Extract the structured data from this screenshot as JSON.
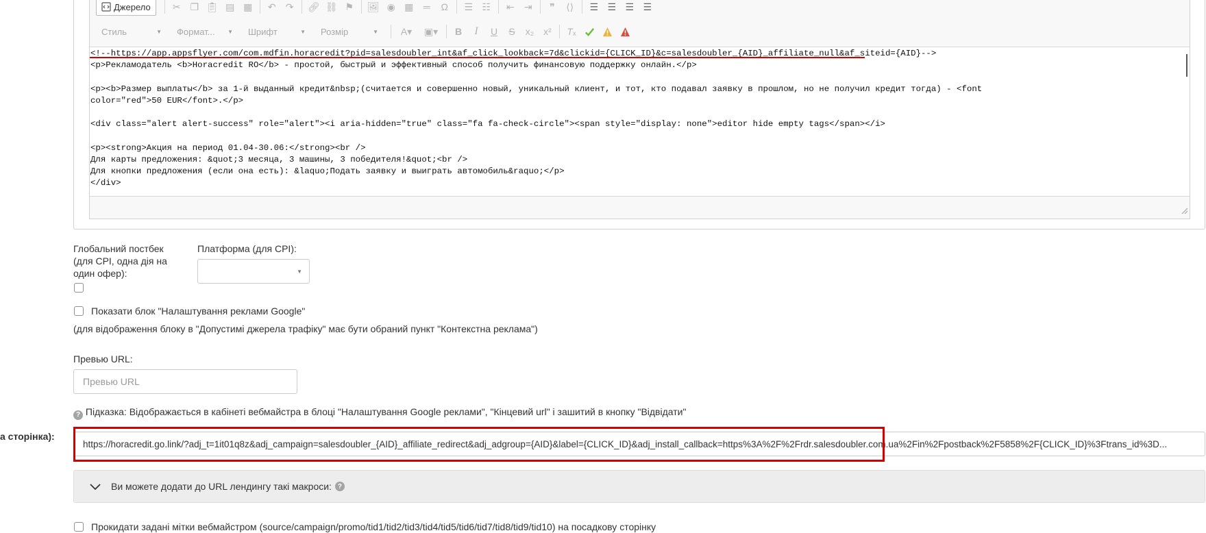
{
  "editor": {
    "source_button": "Джерело",
    "style_combo": "Стиль",
    "format_combo": "Формат...",
    "font_combo": "Шрифт",
    "size_combo": "Розмір",
    "code_lines": [
      "<!--https://app.appsflyer.com/com.mdfin.horacredit?pid=salesdoubler_int&af_click_lookback=7d&clickid={CLICK_ID}&c=salesdoubler_{AID}_affiliate_null&af_siteid={AID}-->",
      "<p>Рекламодатель <b>Horacredit RO</b> - простой, быстрый и эффективный способ получить финансовую поддержку онлайн.</p>",
      "",
      "<p><b>Размер выплаты</b> за 1-й выданный кредит&nbsp;(считается и совершенно новый, уникальный клиент, и тот, кто подавал заявку в прошлом, но не получил кредит тогда) - <font",
      "color=\"red\">50 EUR</font>.</p>",
      "",
      "<div class=\"alert alert-success\" role=\"alert\"><i aria-hidden=\"true\" class=\"fa fa-check-circle\"><span style=\"display: none\">editor hide empty tags</span></i>",
      "",
      "<p><strong>Акция на период 01.04-30.06:</strong><br />",
      "Для карты предложения: &quot;3 месяца, 3 машины, 3 победителя!&quot;<br />",
      "Для кнопки предложения (если она есть): &laquo;Подать заявку и выиграть автомобиль&raquo;</p>",
      "</div>"
    ]
  },
  "form": {
    "global_postback_label": "Глобальний постбек\n(для CPI, одна дія на\nодин офер):",
    "platform_label": "Платформа (для CPI):",
    "platform_value": "",
    "google_block_label": "Показати блок \"Налаштування реклами Google\"",
    "google_block_note": "(для відображення блоку в \"Допустимі джерела трафіку\" має бути обраний пункт \"Контекстна реклама\")",
    "preview_url_label": "Превью URL:",
    "preview_url_placeholder": "Превью URL",
    "hint_text": "Підказка: Відображається в кабінеті вебмайстра в блоці \"Налаштування Google реклами\", \"Кінцевий url\" і зашитий в кнопку \"Відвідати\"",
    "landing_label_fragment": "а сторінка):",
    "landing_url_value": "https://horacredit.go.link/?adj_t=1it01q8z&adj_campaign=salesdoubler_{AID}_affiliate_redirect&adj_adgroup={AID}&label={CLICK_ID}&adj_install_callback=https%3A%2F%2Frdr.salesdoubler.com.ua%2Fin%2Fpostback%2F5858%2F{CLICK_ID}%3Ftrans_id%3D...",
    "macros_label": "Ви можете додати до URL лендингу такі макроси:",
    "pass_tags_label": "Прокидати задані мітки вебмайстром (source/campaign/promo/tid1/tid2/tid3/tid4/tid5/tid6/tid7/tid8/tid9/tid10) на посадкову сторінку"
  },
  "colors": {
    "annotation_red": "#d40000",
    "toolbar_green": "#6fbf3b",
    "toolbar_orange": "#f2b03a",
    "toolbar_red": "#e04a3a"
  }
}
